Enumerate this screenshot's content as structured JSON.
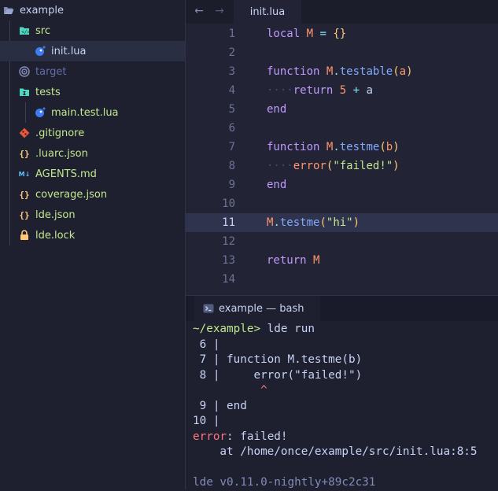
{
  "sidebar": {
    "items": [
      {
        "label": "example",
        "icon": "folder-open-icon"
      },
      {
        "label": "src",
        "icon": "folder-source-icon"
      },
      {
        "label": "init.lua",
        "icon": "lua-file-icon"
      },
      {
        "label": "target",
        "icon": "folder-target-icon"
      },
      {
        "label": "tests",
        "icon": "folder-tests-icon"
      },
      {
        "label": "main.test.lua",
        "icon": "lua-file-icon"
      },
      {
        "label": ".gitignore",
        "icon": "git-icon"
      },
      {
        "label": ".luarc.json",
        "icon": "json-braces-icon"
      },
      {
        "label": "AGENTS.md",
        "icon": "markdown-icon"
      },
      {
        "label": "coverage.json",
        "icon": "json-braces-icon"
      },
      {
        "label": "lde.json",
        "icon": "json-braces-icon"
      },
      {
        "label": "lde.lock",
        "icon": "lock-icon"
      }
    ]
  },
  "editor": {
    "back_arrow": "←",
    "forward_arrow": "→",
    "tab_label": "init.lua",
    "current_line": 11,
    "line_numbers": [
      "1",
      "2",
      "3",
      "4",
      "5",
      "6",
      "7",
      "8",
      "9",
      "10",
      "11",
      "12",
      "13",
      "14"
    ],
    "lines": [
      {
        "local": "local",
        "sp1": " ",
        "M": "M",
        "sp2": " ",
        "eq": "=",
        "sp3": " ",
        "brace": "{}"
      },
      {},
      {
        "kw": "function",
        "sp": " ",
        "obj": "M",
        "dot": ".",
        "name": "testable",
        "p1": "(",
        "arg": "a",
        "p2": ")"
      },
      {
        "dots": "····",
        "kw": "return",
        "sp1": " ",
        "num": "5",
        "sp2": " ",
        "op": "+",
        "sp3": " ",
        "arg": "a"
      },
      {
        "kw": "end"
      },
      {},
      {
        "kw": "function",
        "sp": " ",
        "obj": "M",
        "dot": ".",
        "name": "testme",
        "p1": "(",
        "arg": "b",
        "p2": ")"
      },
      {
        "dots": "····",
        "fn": "error",
        "p1": "(",
        "str": "\"failed!\"",
        "p2": ")"
      },
      {
        "kw": "end"
      },
      {},
      {
        "obj": "M",
        "dot": ".",
        "name": "testme",
        "p1": "(",
        "str": "\"hi\"",
        "p2": ")"
      },
      {},
      {
        "kw": "return",
        "sp": " ",
        "obj": "M"
      },
      {}
    ]
  },
  "terminal": {
    "tab_icon": "terminal-icon",
    "tab_label": "example — bash",
    "prompt": "~/example>",
    "command": " lde run",
    "trace": [
      " 6 |",
      " 7 | function M.testme(b)",
      " 8 |     error(\"failed!\")",
      "          ^",
      " 9 | end",
      "10 |"
    ],
    "error_label": "error",
    "error_msg": ": failed!",
    "location": "    at /home/once/example/src/init.lua:8:5",
    "blank": "",
    "version": "lde v0.11.0-nightly+89c2c31"
  },
  "colors": {
    "background": "#1e2030",
    "editor_bg": "#222436",
    "keyword": "#c099ff",
    "function": "#82aaff",
    "string": "#c3e88d",
    "number": "#ff966c",
    "error": "#ff757f"
  }
}
